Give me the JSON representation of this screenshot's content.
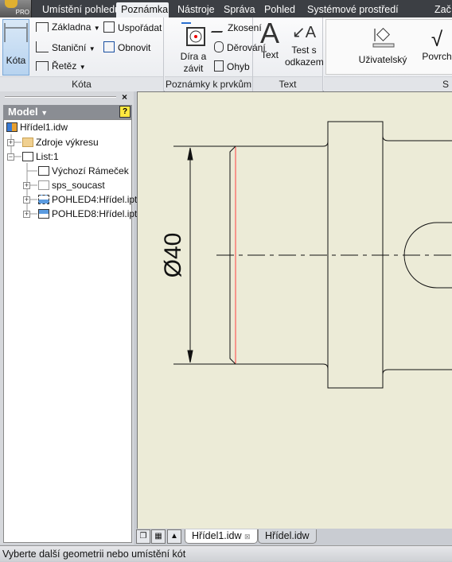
{
  "app": {
    "badge": "PRO"
  },
  "tabs": [
    "Umístění pohledů",
    "Poznámka",
    "Nástroje",
    "Správa",
    "Pohled",
    "Systémové prostředí",
    "Zač"
  ],
  "active_tab": "Poznámka",
  "ribbon": {
    "kota_group": {
      "label": "Kóta",
      "kota": "Kóta",
      "zakladna": "Základna",
      "stanicni": "Staniční",
      "retez": "Řetěz",
      "usporadat": "Uspořádat",
      "obnovit": "Obnovit"
    },
    "features_group": {
      "label": "Poznámky k prvkům",
      "dira1": "Díra a",
      "dira2": "závit",
      "zkoseni": "Zkosení",
      "derovani": "Děrování",
      "ohyb": "Ohyb"
    },
    "text_group": {
      "label": "Text",
      "text": "Text",
      "leader1": "Test s",
      "leader2": "odkazem"
    },
    "symbols_group": {
      "label": "S",
      "uzivatelsky": "Uživatelský",
      "povrch": "Povrch"
    }
  },
  "browser": {
    "title": "Model",
    "help_icon": "?",
    "close_icon": "×",
    "tree": [
      {
        "label": "Hřídel1.idw",
        "icon": "drawing-icon"
      },
      {
        "label": "Zdroje výkresu",
        "icon": "folder-icon",
        "expander": "+"
      },
      {
        "label": "List:1",
        "icon": "sheet-icon",
        "expander": "−"
      },
      {
        "label": "Výchozí Rámeček",
        "icon": "border-icon"
      },
      {
        "label": "sps_soucast",
        "icon": "titleblock-icon",
        "expander": "+"
      },
      {
        "label": "POHLED4:Hřídel.ipt",
        "icon": "view-icon",
        "expander": "+"
      },
      {
        "label": "POHLED8:Hřídel.ipt",
        "icon": "view-icon",
        "expander": "+"
      }
    ]
  },
  "drawing": {
    "dimension_text": "Ø40",
    "line_color": "#000000",
    "highlight_color": "#ff4040",
    "background": "#ecebd7"
  },
  "doc_tabs": [
    {
      "label": "Hřídel1.idw",
      "active": true
    },
    {
      "label": "Hřídel.idw",
      "active": false
    }
  ],
  "status": "Vyberte další geometrii nebo umístění kót"
}
